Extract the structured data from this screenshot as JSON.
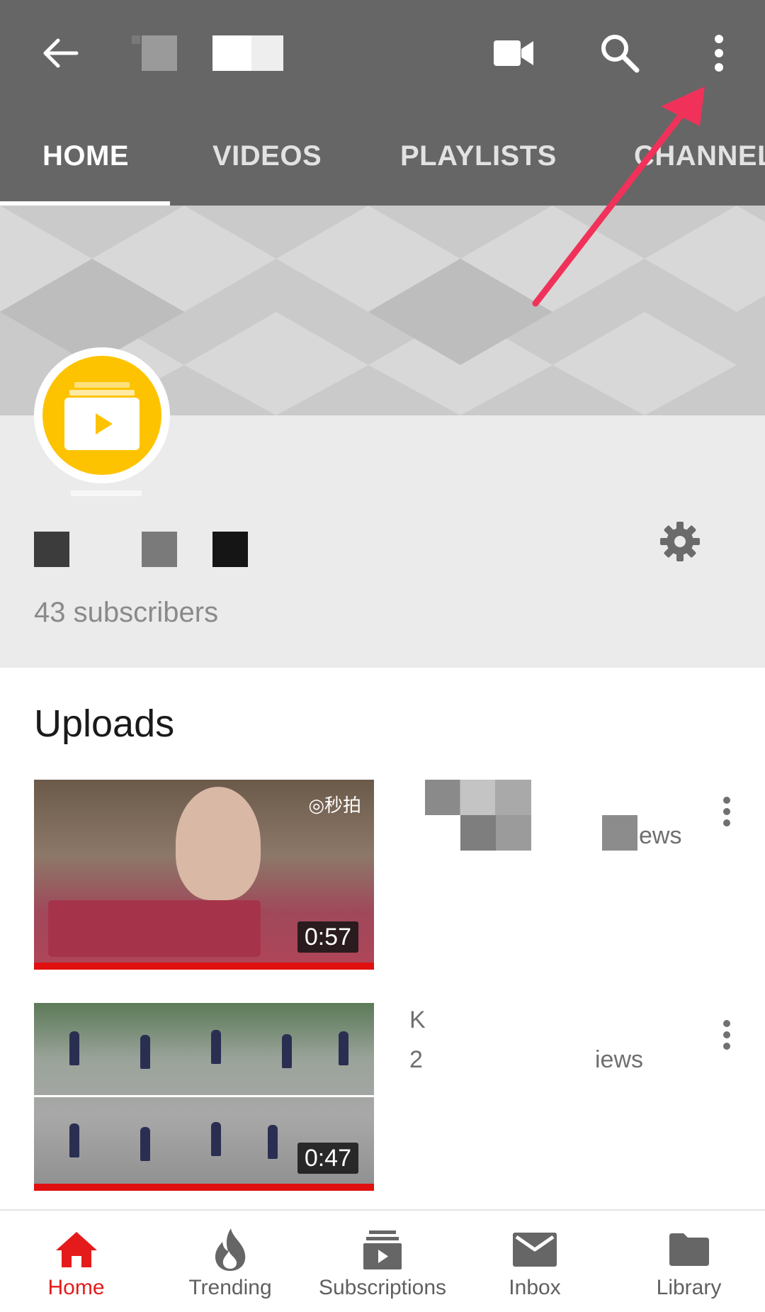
{
  "appbar": {
    "icons": [
      "back-arrow-icon",
      "video-camera-icon",
      "search-icon",
      "more-vert-icon"
    ],
    "tabs": [
      {
        "label": "HOME",
        "active": true
      },
      {
        "label": "VIDEOS",
        "active": false
      },
      {
        "label": "PLAYLISTS",
        "active": false
      },
      {
        "label": "CHANNEL",
        "active": false
      }
    ],
    "colors": {
      "bar": "#666666",
      "active_tab": "#ffffff"
    }
  },
  "channel": {
    "subscribers": "43 subscribers",
    "avatar_color": "#fdc300",
    "settings_icon": "gear-icon"
  },
  "uploads": {
    "title": "Uploads",
    "videos": [
      {
        "duration": "0:57",
        "watermark": "◎秒拍",
        "views_fragment": "ews"
      },
      {
        "duration": "0:47",
        "title_fragment": "K",
        "line2_fragment": "2",
        "views_fragment": "iews"
      }
    ]
  },
  "bottom_nav": {
    "items": [
      {
        "label": "Home",
        "icon": "home-icon",
        "active": true
      },
      {
        "label": "Trending",
        "icon": "flame-icon",
        "active": false
      },
      {
        "label": "Subscriptions",
        "icon": "subscriptions-icon",
        "active": false
      },
      {
        "label": "Inbox",
        "icon": "mail-icon",
        "active": false
      },
      {
        "label": "Library",
        "icon": "folder-icon",
        "active": false
      }
    ],
    "active_color": "#e51b1b"
  },
  "annotation": {
    "arrow_color": "#f0325a"
  }
}
